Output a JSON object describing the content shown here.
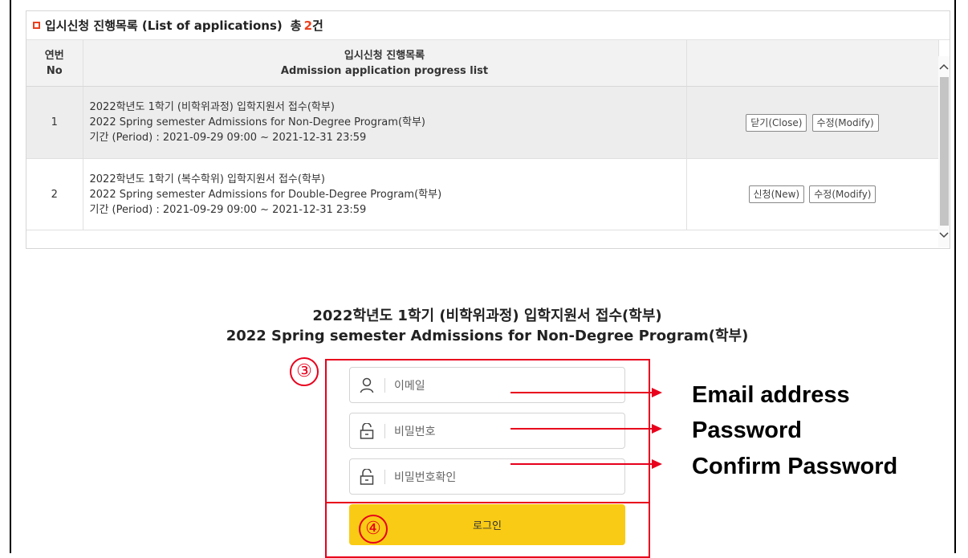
{
  "panel": {
    "title": "입시신청 진행목록 (List of applications)",
    "count_prefix": "총",
    "count_value": "2",
    "count_suffix": "건"
  },
  "table": {
    "header_no_kr": "연번",
    "header_no_en": "No",
    "header_list_kr": "입시신청 진행목록",
    "header_list_en": "Admission application progress list",
    "rows": [
      {
        "no": "1",
        "title_kr": "2022학년도 1학기 (비학위과정) 입학지원서 접수(학부)",
        "title_en": "2022 Spring semester Admissions for Non-Degree Program(학부)",
        "period": "기간 (Period) : 2021-09-29 09:00 ~ 2021-12-31 23:59",
        "btn1": "닫기(Close)",
        "btn2": "수정(Modify)"
      },
      {
        "no": "2",
        "title_kr": "2022학년도 1학기 (복수학위) 입학지원서 접수(학부)",
        "title_en": "2022 Spring semester Admissions for Double-Degree Program(학부)",
        "period": "기간 (Period) : 2021-09-29 09:00 ~ 2021-12-31 23:59",
        "btn1": "신청(New)",
        "btn2": "수정(Modify)"
      }
    ]
  },
  "form": {
    "title_kr": "2022학년도 1학기 (비학위과정) 입학지원서 접수(학부)",
    "title_en": "2022 Spring semester Admissions for Non-Degree Program(학부)",
    "email_placeholder": "이메일",
    "password_placeholder": "비밀번호",
    "confirm_placeholder": "비밀번호확인",
    "login_label": "로그인",
    "step3": "③",
    "step4": "④"
  },
  "annotations": {
    "email": "Email address",
    "password": "Password",
    "confirm": "Confirm Password"
  },
  "colors": {
    "accent_red": "#e8001c",
    "count_red": "#e8411e",
    "login_yellow": "#f9cb14"
  }
}
